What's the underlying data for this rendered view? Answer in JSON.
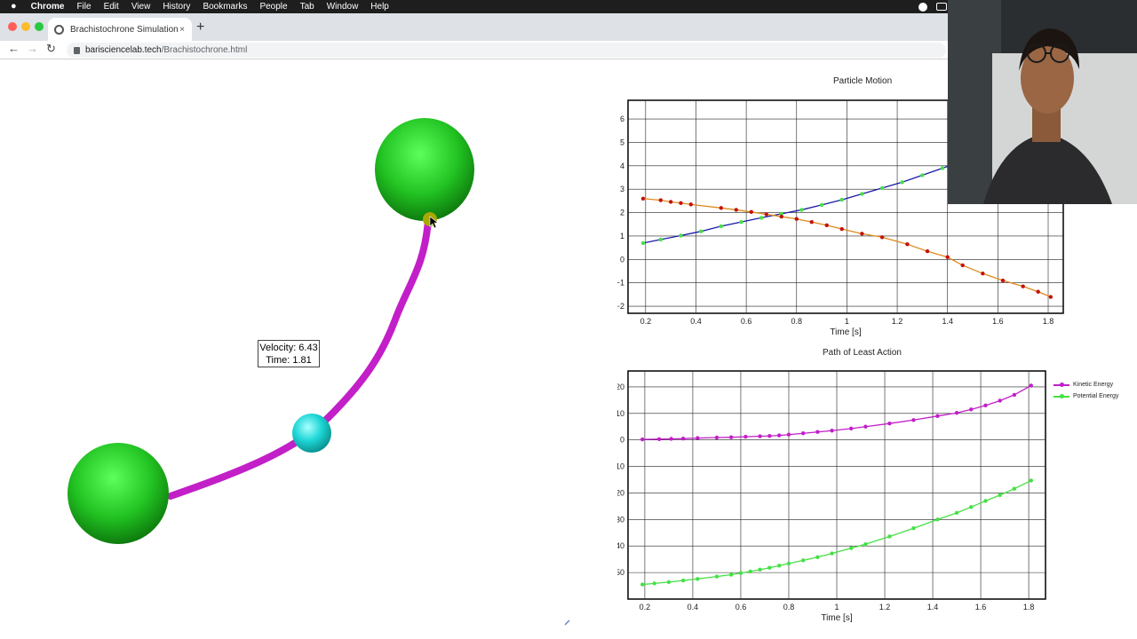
{
  "menubar": {
    "app": "Chrome",
    "items": [
      "File",
      "Edit",
      "View",
      "History",
      "Bookmarks",
      "People",
      "Tab",
      "Window",
      "Help"
    ]
  },
  "browser": {
    "tab_title": "Brachistochrone Simulation",
    "tab_close": "×",
    "new_tab": "+",
    "url_host": "barisciencelab.tech",
    "url_path": "/Brachistochrone.html",
    "back": "←",
    "forward": "→",
    "reload": "↻"
  },
  "simulation": {
    "velocity_label": "Velocity: 6.43",
    "time_label": "Time: 1.81",
    "colors": {
      "sphere": "#22c322",
      "track": "#c21fc8",
      "particle": "#1ed6d6",
      "marker": "#a8a800"
    }
  },
  "chart_data": [
    {
      "type": "line",
      "title": "Particle Motion",
      "xlabel": "Time [s]",
      "ylabel": "",
      "xlim": [
        0.13,
        1.86
      ],
      "ylim": [
        -2.3,
        6.8
      ],
      "xticks": [
        0.2,
        0.4,
        0.6,
        0.8,
        1,
        1.2,
        1.4,
        1.6,
        1.8
      ],
      "xtick_labels": [
        "0.2",
        "0.4",
        "0.6",
        "0.8",
        "1",
        "1.2",
        "1.4",
        "1.6",
        "1.8"
      ],
      "yticks": [
        6,
        5,
        4,
        3,
        2,
        1,
        0,
        -1,
        -2
      ],
      "ytick_labels": [
        "6",
        "5",
        "4",
        "3",
        "2",
        "1",
        "0",
        "−1",
        "−2"
      ],
      "grid": true,
      "series": [
        {
          "line_color": "#1a1aa8",
          "marker_color": "#45e045",
          "x": [
            0.19,
            0.26,
            0.34,
            0.42,
            0.5,
            0.58,
            0.66,
            0.74,
            0.82,
            0.9,
            0.98,
            1.06,
            1.14,
            1.22,
            1.3,
            1.38,
            1.46,
            1.54,
            1.62,
            1.7,
            1.81
          ],
          "y": [
            0.7,
            0.85,
            1.02,
            1.2,
            1.42,
            1.6,
            1.78,
            1.95,
            2.12,
            2.33,
            2.55,
            2.8,
            3.05,
            3.3,
            3.6,
            3.9,
            4.2,
            4.5,
            4.8,
            5.1,
            5.5
          ]
        },
        {
          "line_color": "#e08a1a",
          "marker_color": "#c4120a",
          "x": [
            0.19,
            0.26,
            0.3,
            0.34,
            0.38,
            0.5,
            0.56,
            0.62,
            0.68,
            0.74,
            0.8,
            0.86,
            0.92,
            0.98,
            1.06,
            1.14,
            1.24,
            1.32,
            1.4,
            1.46,
            1.54,
            1.62,
            1.7,
            1.76,
            1.81
          ],
          "y": [
            2.6,
            2.53,
            2.46,
            2.41,
            2.35,
            2.2,
            2.12,
            2.03,
            1.93,
            1.83,
            1.73,
            1.6,
            1.46,
            1.3,
            1.1,
            0.95,
            0.65,
            0.35,
            0.1,
            -0.25,
            -0.6,
            -0.9,
            -1.15,
            -1.38,
            -1.6
          ]
        }
      ]
    },
    {
      "type": "line",
      "title": "Path of Least Action",
      "xlabel": "Time [s]",
      "ylabel": "",
      "xlim": [
        0.13,
        1.87
      ],
      "ylim": [
        -60,
        26
      ],
      "xticks": [
        0.2,
        0.4,
        0.6,
        0.8,
        1,
        1.2,
        1.4,
        1.6,
        1.8
      ],
      "xtick_labels": [
        "0.2",
        "0.4",
        "0.6",
        "0.8",
        "1",
        "1.2",
        "1.4",
        "1.6",
        "1.8"
      ],
      "yticks": [
        20,
        10,
        0,
        -10,
        -20,
        -30,
        -40,
        -50
      ],
      "ytick_labels": [
        "20",
        "10",
        "0",
        "−10",
        "−20",
        "−30",
        "−40",
        "−50"
      ],
      "grid": true,
      "legend_position": "right",
      "series": [
        {
          "name": "Kinetic Energy",
          "line_color": "#c21fc8",
          "marker_color": "#c21fc8",
          "x": [
            0.19,
            0.26,
            0.31,
            0.36,
            0.42,
            0.5,
            0.56,
            0.62,
            0.68,
            0.72,
            0.76,
            0.8,
            0.86,
            0.92,
            0.98,
            1.06,
            1.12,
            1.22,
            1.32,
            1.42,
            1.5,
            1.56,
            1.62,
            1.68,
            1.74,
            1.81
          ],
          "y": [
            0.2,
            0.3,
            0.4,
            0.5,
            0.7,
            0.9,
            1.0,
            1.2,
            1.4,
            1.5,
            1.7,
            2.0,
            2.5,
            3.0,
            3.5,
            4.3,
            5.0,
            6.2,
            7.5,
            9.0,
            10.2,
            11.5,
            13.0,
            14.8,
            17.0,
            20.5
          ]
        },
        {
          "name": "Potential Energy",
          "line_color": "#45e045",
          "marker_color": "#45e045",
          "x": [
            0.19,
            0.24,
            0.3,
            0.36,
            0.42,
            0.5,
            0.56,
            0.6,
            0.64,
            0.68,
            0.72,
            0.76,
            0.8,
            0.86,
            0.92,
            0.98,
            1.06,
            1.12,
            1.22,
            1.32,
            1.42,
            1.5,
            1.56,
            1.62,
            1.68,
            1.74,
            1.81
          ],
          "y": [
            -54.5,
            -54.1,
            -53.6,
            -53.0,
            -52.4,
            -51.5,
            -50.8,
            -50.2,
            -49.6,
            -48.9,
            -48.2,
            -47.4,
            -46.6,
            -45.4,
            -44.2,
            -42.8,
            -40.8,
            -39.3,
            -36.4,
            -33.3,
            -30.0,
            -27.5,
            -25.3,
            -23.0,
            -20.8,
            -18.4,
            -15.3
          ]
        }
      ]
    }
  ]
}
